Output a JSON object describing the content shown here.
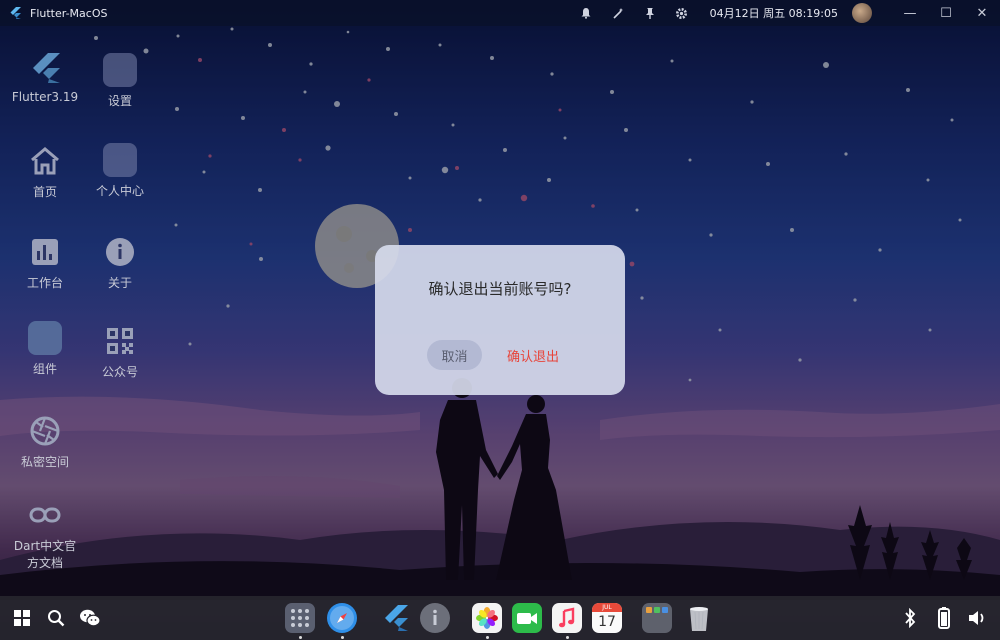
{
  "window": {
    "title": "Flutter-MacOS"
  },
  "topbar": {
    "datetime": "04月12日 周五 08:19:05",
    "icons": [
      "bell-icon",
      "magic-wand-icon",
      "pin-icon",
      "gear-icon"
    ],
    "window_controls": {
      "minimize": "—",
      "maximize": "☐",
      "close": "✕"
    }
  },
  "desktop": {
    "items": [
      {
        "label": "Flutter3.19",
        "icon": "flutter-logo-icon"
      },
      {
        "label": "设置",
        "icon": "settings-tile-icon"
      },
      {
        "label": "首页",
        "icon": "home-icon"
      },
      {
        "label": "个人中心",
        "icon": "profile-tile-icon"
      },
      {
        "label": "工作台",
        "icon": "chart-icon"
      },
      {
        "label": "关于",
        "icon": "info-icon"
      },
      {
        "label": "组件",
        "icon": "components-tile-icon"
      },
      {
        "label": "公众号",
        "icon": "qrcode-icon"
      },
      {
        "label": "私密空间",
        "icon": "aperture-icon"
      },
      {
        "label": "Dart中文官方文档",
        "label_line1": "Dart中文官",
        "label_line2": "方文档",
        "icon": "link-icon"
      }
    ]
  },
  "dialog": {
    "message": "确认退出当前账号吗?",
    "cancel_label": "取消",
    "confirm_label": "确认退出",
    "confirm_color": "#e8443a"
  },
  "taskbar": {
    "left_icons": [
      "windows-icon",
      "search-icon",
      "wechat-icon"
    ],
    "dock_apps": [
      "launchpad-icon",
      "safari-icon",
      "flutter-icon",
      "info-icon",
      "photos-icon",
      "facetime-icon",
      "music-icon",
      "calendar-icon",
      "folder-icon",
      "trash-icon"
    ],
    "calendar": {
      "month": "JUL",
      "day": "17"
    },
    "right_icons": [
      "bluetooth-icon",
      "battery-icon",
      "volume-icon"
    ]
  }
}
